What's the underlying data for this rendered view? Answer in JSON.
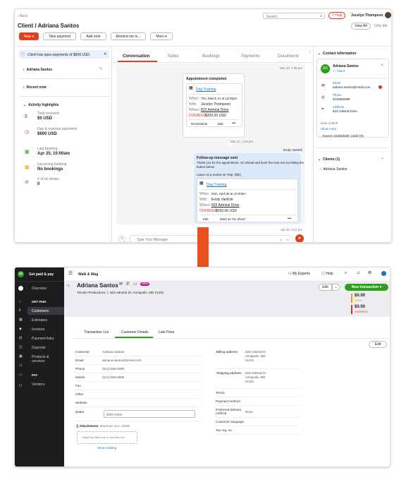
{
  "top": {
    "back": "Back",
    "search_placeholder": "Search",
    "help": "Help",
    "user": "Jocelyn Thompson",
    "title": "Client / Adriana Santos",
    "view_all": "View All",
    "only_me": "Only Me",
    "actions": {
      "new": "New",
      "take_payment": "Take payment",
      "add_note": "Add note",
      "remind": "Remind me in...",
      "more": "More"
    },
    "banner": "Client has open payments of $600 USD.",
    "client_name": "Adriana Santos",
    "recent_note": "Recent note",
    "activity_title": "Activity highlights",
    "highlights": [
      {
        "label": "Total received",
        "value": "$0 USD"
      },
      {
        "label": "Due & overdue payments",
        "value": "$600 USD"
      },
      {
        "label": "Last booking",
        "value": "Apr 25, 10:00am"
      },
      {
        "label": "Upcoming booking",
        "value": "No bookings"
      },
      {
        "label": "# of no shows",
        "value": "0"
      }
    ],
    "tabs": [
      "Conversation",
      "Notes",
      "Bookings",
      "Payments",
      "Documents"
    ],
    "ts1": "Mar 29, 7:35 pm",
    "appt": {
      "title": "Appointment completed",
      "service": "Dog Training",
      "when": "Thu, March 31 at 12:00pm",
      "with": "Jocelyn Thompson",
      "where": "823 Admiral Drive",
      "overdue_amount": "$200.00 USD",
      "reschedule": "Reschedule",
      "edit": "Edit",
      "more": "•••"
    },
    "ts2": "Mar 31, 1:16 pm",
    "sender": "Emily VanKirk",
    "followup": {
      "title": "Follow-up message sent",
      "body1": "Thank you for the appointment. Go ahead and book the next one by hitting the",
      "body2": "button below.",
      "review": "Leave us a review on Yelp: (link)",
      "service": "Dog Training",
      "when": "Mon, April 25 at 10:00am",
      "with": "Emily VanKirk",
      "where": "823 Admiral Drive",
      "overdue_amount": "$200.00 USD",
      "edit": "Edit",
      "no_show": "Mark as 'No Show'",
      "more": "•••"
    },
    "ts3": "Apr 25, 3:27 pm",
    "message_placeholder": "Type Your Message",
    "labels": {
      "when": "When:",
      "with": "With:",
      "where": "Where:",
      "overdue": "OVERDUE"
    },
    "contact": {
      "title": "Contact information",
      "name": "Adriana Santos",
      "initials": "AS",
      "tag": "Client",
      "email_label": "Email",
      "email": "adriana.santos@email.com",
      "phone_label": "Phone",
      "phone": "5125556089",
      "address_label": "Address",
      "address": "823 Admiral Drive",
      "dob": "Date of Birth",
      "show_more": "Show more",
      "saved_cards": "Saved credit/debit cards (0)",
      "clients": "Clients (1)",
      "client_item": "Adriana Santos"
    }
  },
  "bottom": {
    "brand": "Get paid & pay",
    "app": "Walk & Wag",
    "my_experts": "My Experts",
    "help": "Help",
    "nav": [
      "Overview",
      "GET PAID",
      "Customers",
      "Estimates",
      "Invoices",
      "Payment links",
      "Deposits",
      "Products & services",
      "PAY",
      "Vendors"
    ],
    "name": "Adriana Santos",
    "badge": "NEW",
    "company": "Tricolor Productions",
    "address_line": "823 Admiral Dr, Annapolis, MD 21401",
    "edit": "Edit",
    "new_transaction": "New transaction",
    "open_amount": "$0.00",
    "open_label": "OPEN",
    "overdue_amount": "$0.00",
    "overdue_label": "OVERDUE",
    "tabs": [
      "Transaction List",
      "Customer Details",
      "Late Fees"
    ],
    "edit2": "Edit",
    "left_rows": [
      {
        "k": "Customer",
        "v": "Adriana Santos"
      },
      {
        "k": "Email",
        "v": "adriana.santos@email.com"
      },
      {
        "k": "Phone",
        "v": "(512) 555-6089"
      },
      {
        "k": "Mobile",
        "v": "(512) 555-8686"
      },
      {
        "k": "Fax",
        "v": ""
      },
      {
        "k": "Other",
        "v": ""
      },
      {
        "k": "Website",
        "v": ""
      }
    ],
    "notes_label": "Notes",
    "notes_placeholder": "Add notes",
    "attachments": "Attachments",
    "max_size": "Maximum size: 20MB",
    "drop": "Drag/Drop files here or click the icon",
    "show_existing": "Show existing",
    "billing_label": "Billing address",
    "billing": [
      "823 Admiral Dr",
      "Annapolis, MD",
      "21401"
    ],
    "shipping_label": "Shipping address",
    "shipping": [
      "823 Admiral Dr",
      "Annapolis, MD",
      "21401"
    ],
    "right_rows": [
      {
        "k": "Terms",
        "v": ""
      },
      {
        "k": "Payment method",
        "v": ""
      },
      {
        "k": "Preferred delivery method",
        "v": "None"
      },
      {
        "k": "Customer language",
        "v": ""
      },
      {
        "k": "Tax reg. no.",
        "v": ""
      }
    ]
  },
  "colors": {
    "accent_red": "#e0401c",
    "qb_green": "#2ca01c",
    "arrow": "#e8531e"
  }
}
